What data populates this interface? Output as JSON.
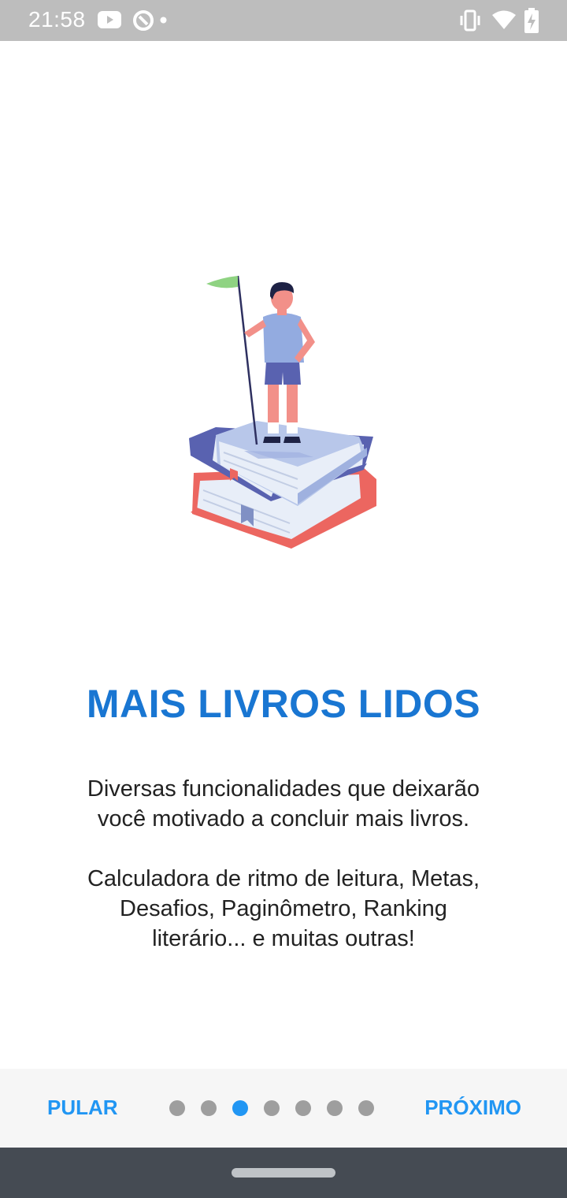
{
  "status_bar": {
    "time": "21:58",
    "left_icons": [
      "youtube-icon",
      "sync-icon",
      "dot-icon"
    ],
    "right_icons": [
      "vibrate-icon",
      "wifi-icon",
      "battery-charging-icon"
    ]
  },
  "onboarding": {
    "illustration": "person-on-books-with-flag",
    "title": "MAIS LIVROS LIDOS",
    "description_lines": [
      "Diversas funcionalidades que deixarão",
      "você motivado a concluir mais livros."
    ],
    "features_lines": [
      "Calculadora de ritmo de leitura, Metas,",
      "Desafios, Paginômetro, Ranking",
      "literário... e muitas outras!"
    ]
  },
  "footer": {
    "skip_label": "PULAR",
    "next_label": "PRÓXIMO",
    "page_count": 7,
    "current_page": 3
  },
  "colors": {
    "accent": "#2196f3",
    "title": "#1976d2",
    "status_bar": "#bdbdbd",
    "nav_bar": "#454b53",
    "dot_inactive": "#9e9e9e"
  }
}
